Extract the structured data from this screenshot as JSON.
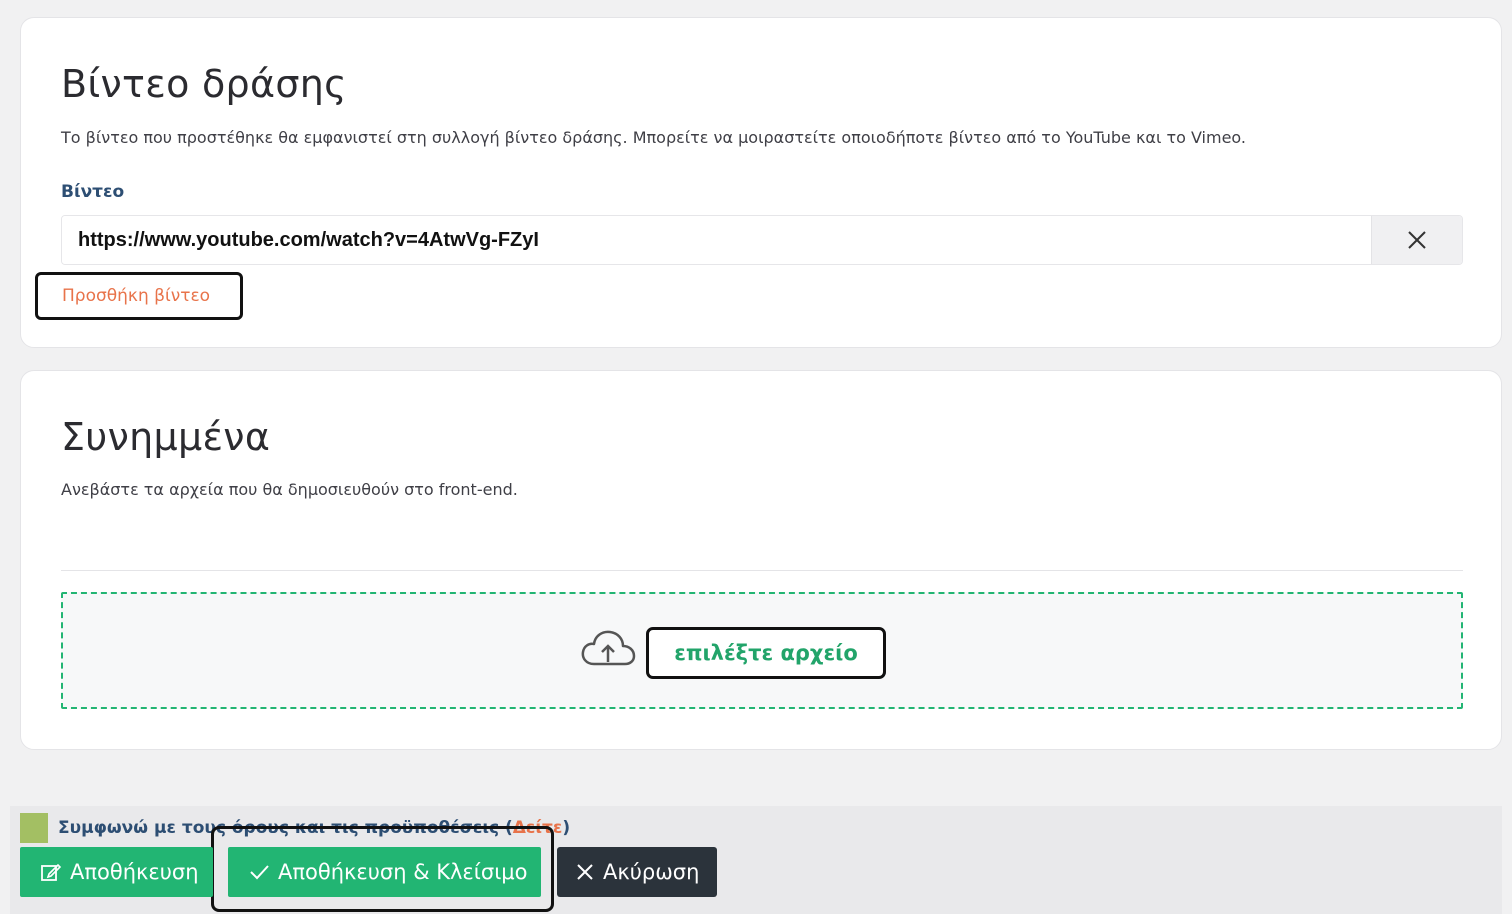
{
  "video_section": {
    "title": "Βίντεο δράσης",
    "description": "Το βίντεο που προστέθηκε θα εμφανιστεί στη συλλογή βίντεο δράσης. Μπορείτε να μοιραστείτε οποιοδήποτε βίντεο από το YouTube και το Vimeo.",
    "field_label": "Βίντεο",
    "url_value": "https://www.youtube.com/watch?v=4AtwVg-FZyI",
    "clear_icon": "close-icon",
    "add_video_label": "Προσθήκη βίντεο"
  },
  "attachments_section": {
    "title": "Συνημμένα",
    "description": "Ανεβάστε τα αρχεία που θα δημοσιευθούν στο front-end.",
    "upload_icon": "cloud-upload-icon",
    "choose_file_label": "επιλέξτε αρχείο"
  },
  "footer": {
    "terms_text": "Συμφωνώ με τους όρους και τις προϋποθέσεις (",
    "terms_link": "Δείτε",
    "terms_close": ")",
    "save_label": "Αποθήκευση",
    "save_close_label": "Αποθήκευση & Κλείσιμο",
    "cancel_label": "Ακύρωση"
  },
  "colors": {
    "accent_green": "#22b573",
    "link_orange": "#e8734a",
    "label_blue": "#2d4e73",
    "cancel_dark": "#2b333b"
  }
}
